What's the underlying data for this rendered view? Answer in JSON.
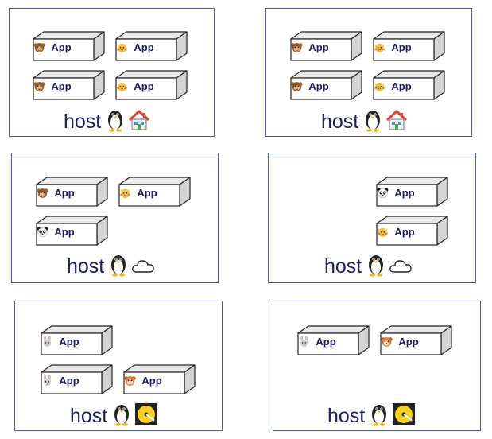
{
  "app_label": "App",
  "host_label": "host",
  "hosts": [
    {
      "id": "host-1",
      "apps": [
        "monkey",
        "cat",
        "monkey",
        "cat"
      ],
      "icons": [
        "penguin",
        "house"
      ]
    },
    {
      "id": "host-2",
      "apps": [
        "monkey",
        "cat",
        "monkey",
        "cat"
      ],
      "icons": [
        "penguin",
        "house"
      ]
    },
    {
      "id": "host-3",
      "apps": [
        "monkey",
        "cat",
        "panda"
      ],
      "icons": [
        "penguin",
        "cloud"
      ]
    },
    {
      "id": "host-4",
      "apps": [
        "panda",
        "cat"
      ],
      "icons": [
        "penguin",
        "cloud"
      ]
    },
    {
      "id": "host-5",
      "apps": [
        "rabbit",
        "rabbit",
        "hamster"
      ],
      "icons": [
        "penguin",
        "disk"
      ]
    },
    {
      "id": "host-6",
      "apps": [
        "rabbit",
        "hamster"
      ],
      "icons": [
        "penguin",
        "disk"
      ]
    }
  ],
  "colors": {
    "border": "#4a5a9c",
    "text": "#1c1c5a",
    "box_top": "#e9e9e9",
    "box_side": "#d4d4d4",
    "box_front": "#ffffff"
  }
}
